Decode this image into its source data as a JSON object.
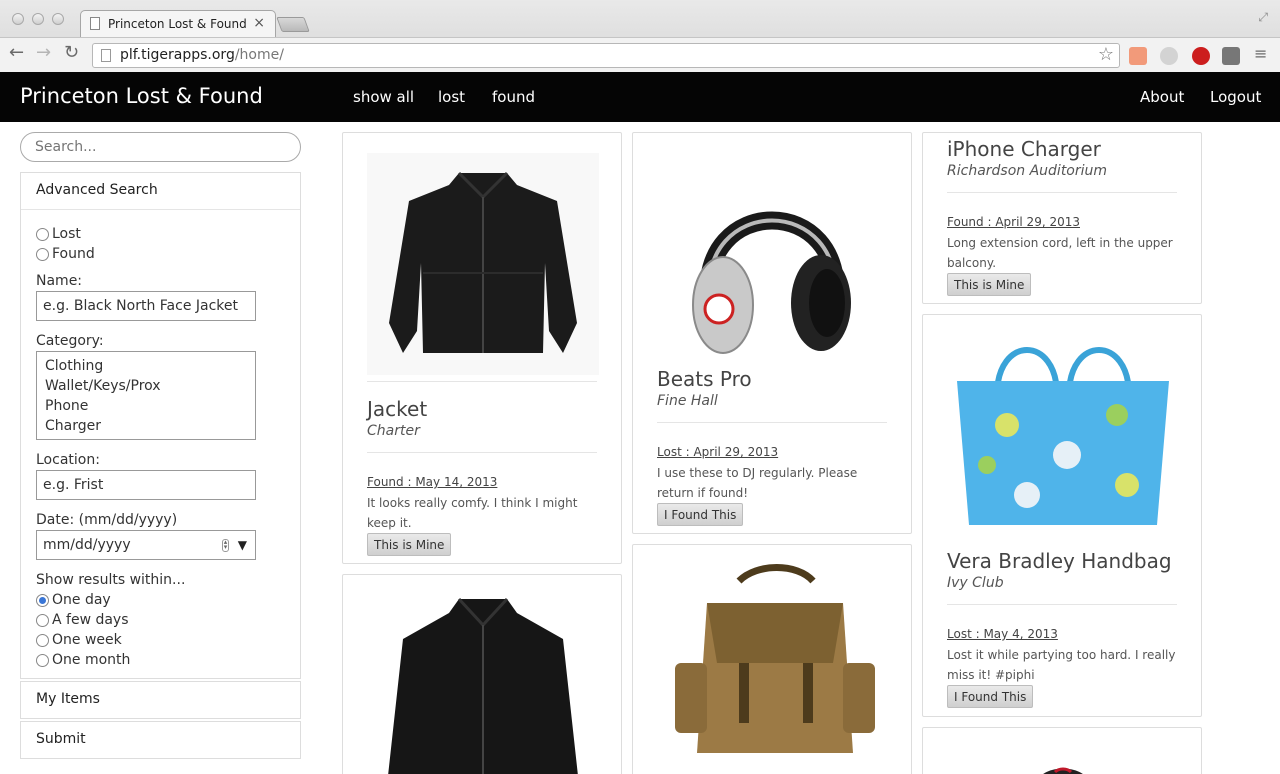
{
  "browser": {
    "tab_title": "Princeton Lost & Found",
    "tab_close": "×",
    "url_host": "plf.tigerapps.org",
    "url_path": "/home/",
    "back_icon": "arrow-left-icon",
    "forward_icon": "arrow-right-icon",
    "reload_icon": "reload-icon",
    "menu_icon": "hamburger-icon"
  },
  "header": {
    "title": "Princeton Lost & Found",
    "nav": [
      "show all",
      "lost",
      "found"
    ],
    "right": [
      "About",
      "Logout"
    ]
  },
  "sidebar": {
    "search_placeholder": "Search...",
    "advanced_search": {
      "title": "Advanced Search",
      "type_options": [
        "Lost",
        "Found"
      ],
      "name_label": "Name:",
      "name_placeholder": "e.g. Black North Face Jacket",
      "category_label": "Category:",
      "categories": [
        "Clothing",
        "Wallet/Keys/Prox",
        "Phone",
        "Charger"
      ],
      "location_label": "Location:",
      "location_placeholder": "e.g. Frist",
      "date_label": "Date: (mm/dd/yyyy)",
      "date_placeholder": "mm/dd/yyyy",
      "within_label": "Show results within...",
      "within_options": [
        "One day",
        "A few days",
        "One week",
        "One month"
      ],
      "within_selected": "One day"
    },
    "my_items": "My Items",
    "submit": "Submit"
  },
  "items": [
    {
      "title": "Jacket",
      "location": "Charter",
      "status": "Found : May 14, 2013",
      "description": "It looks really comfy. I think I might keep it.",
      "action": "This is Mine"
    },
    {
      "title": "Beats Pro",
      "location": "Fine Hall",
      "status": "Lost : April 29, 2013",
      "description": "I use these to DJ regularly. Please return if found!",
      "action": "I Found This"
    },
    {
      "title": "iPhone Charger",
      "location": "Richardson Auditorium",
      "status": "Found : April 29, 2013",
      "description": "Long extension cord, left in the upper balcony.",
      "action": "This is Mine"
    },
    {
      "title": "Vera Bradley Handbag",
      "location": "Ivy Club",
      "status": "Lost : May 4, 2013",
      "description": "Lost it while partying too hard. I really miss it! #piphi",
      "action": "I Found This"
    }
  ]
}
